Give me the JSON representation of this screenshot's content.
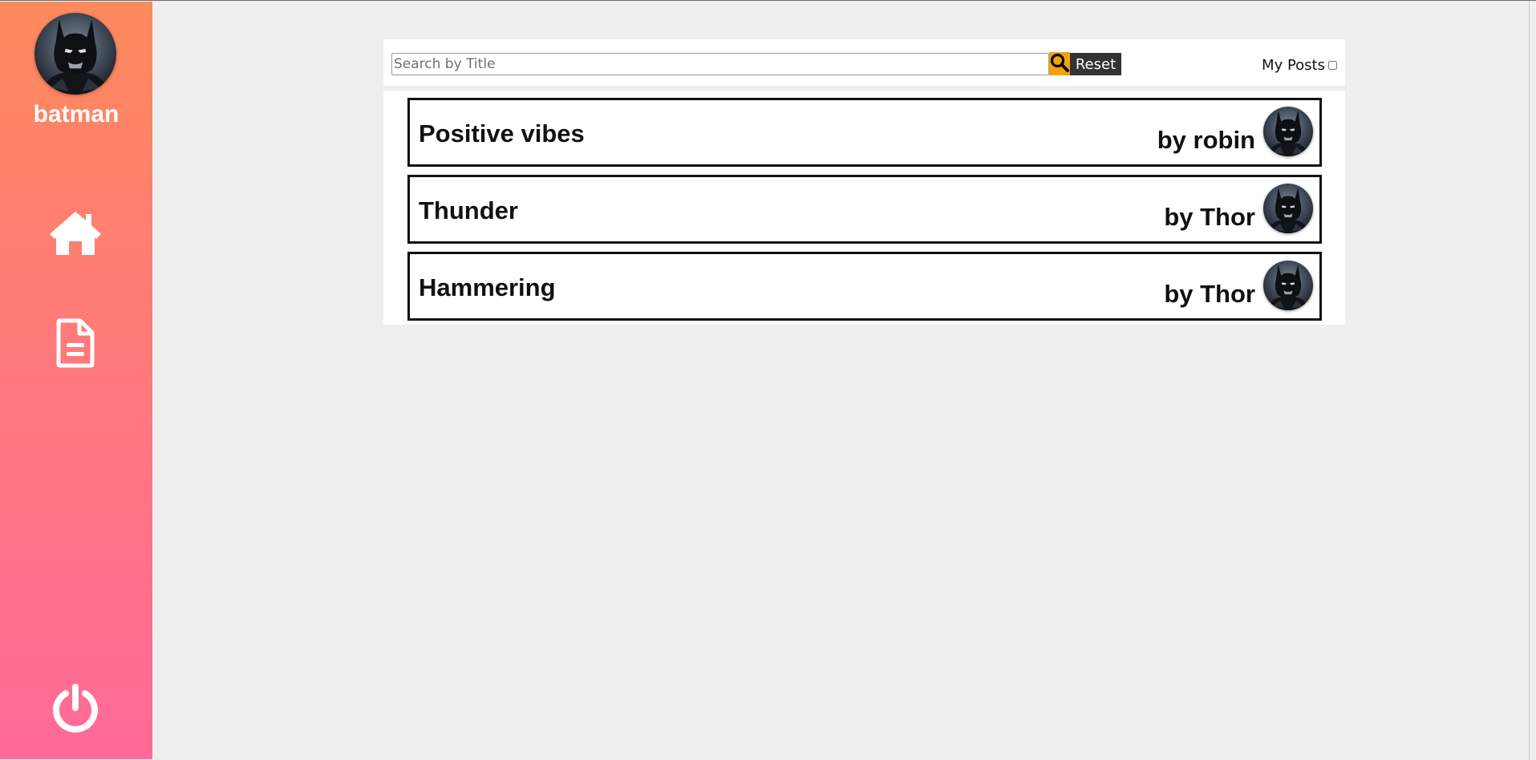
{
  "sidebar": {
    "username": "batman",
    "avatar_icon": "batman-avatar-icon",
    "nav": [
      {
        "icon": "home-icon"
      },
      {
        "icon": "document-icon"
      }
    ],
    "logout_icon": "power-icon",
    "gradient_top": "#ff8a5c",
    "gradient_bottom": "#ff6a98"
  },
  "toolbar": {
    "search_placeholder": "Search by Title",
    "search_value": "",
    "search_button_icon": "search-icon",
    "search_button_color": "#f4a20c",
    "reset_label": "Reset",
    "my_posts_label": "My Posts",
    "my_posts_checked": false
  },
  "posts": [
    {
      "title": "Positive vibes",
      "author": "by robin"
    },
    {
      "title": "Thunder",
      "author": "by Thor"
    },
    {
      "title": "Hammering",
      "author": "by Thor"
    }
  ]
}
